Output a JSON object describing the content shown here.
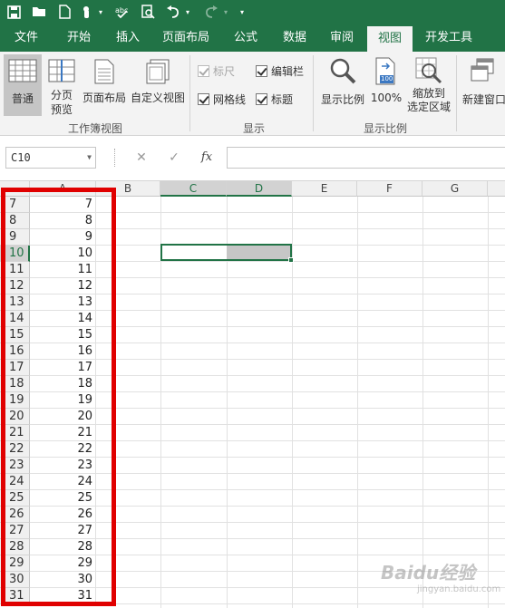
{
  "quick_access": {
    "icons": [
      "save-icon",
      "open-icon",
      "new-icon",
      "touch-mode-icon",
      "spelling-icon",
      "print-preview-icon",
      "undo-icon",
      "redo-icon",
      "customize-icon"
    ]
  },
  "tabs": [
    {
      "label": "文件",
      "active": false
    },
    {
      "label": "开始",
      "active": false
    },
    {
      "label": "插入",
      "active": false
    },
    {
      "label": "页面布局",
      "active": false
    },
    {
      "label": "公式",
      "active": false
    },
    {
      "label": "数据",
      "active": false
    },
    {
      "label": "审阅",
      "active": false
    },
    {
      "label": "视图",
      "active": true
    },
    {
      "label": "开发工具",
      "active": false
    }
  ],
  "ribbon": {
    "workbook_views": {
      "group_label": "工作簿视图",
      "normal": "普通",
      "page_break_preview": "分页\n预览",
      "page_layout": "页面布局",
      "custom_views": "自定义视图"
    },
    "show": {
      "group_label": "显示",
      "ruler": {
        "label": "标尺",
        "checked": true,
        "enabled": false
      },
      "formula_bar": {
        "label": "编辑栏",
        "checked": true,
        "enabled": true
      },
      "gridlines": {
        "label": "网格线",
        "checked": true,
        "enabled": true
      },
      "headings": {
        "label": "标题",
        "checked": true,
        "enabled": true
      }
    },
    "zoom": {
      "group_label": "显示比例",
      "zoom": "显示比例",
      "hundred": "100%",
      "hundred_badge": "100",
      "zoom_to_selection": "缩放到\n选定区域"
    },
    "window": {
      "new_window": "新建窗口"
    }
  },
  "formula_bar": {
    "name_box": "C10",
    "cancel": "✕",
    "enter": "✓",
    "fx": "fx",
    "value": ""
  },
  "sheet": {
    "columns": [
      "A",
      "B",
      "C",
      "D",
      "E",
      "F",
      "G"
    ],
    "selected_columns": [
      "C",
      "D"
    ],
    "rows": [
      7,
      8,
      9,
      10,
      11,
      12,
      13,
      14,
      15,
      16,
      17,
      18,
      19,
      20,
      21,
      22,
      23,
      24,
      25,
      26,
      27,
      28,
      29,
      30,
      31
    ],
    "selected_row": 10,
    "column_a_values": [
      "7",
      "8",
      "9",
      "10",
      "11",
      "12",
      "13",
      "14",
      "15",
      "16",
      "17",
      "18",
      "19",
      "20",
      "21",
      "22",
      "23",
      "24",
      "25",
      "26",
      "27",
      "28",
      "29",
      "30",
      "31"
    ],
    "selection": "C10:D10",
    "highlight_color": "#e00000",
    "accent_color": "#217346"
  },
  "watermark": {
    "main": "Baidu经验",
    "sub": "jingyan.baidu.com"
  }
}
